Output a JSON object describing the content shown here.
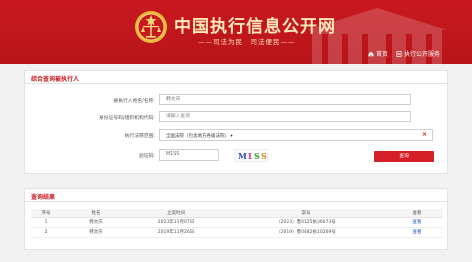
{
  "header": {
    "site_title": "中国执行信息公开网",
    "slogan": "——司法为民　司法便民——",
    "nav": [
      {
        "label": "首页",
        "icon": "home-icon"
      },
      {
        "label": "执行公开服务",
        "icon": "document-icon"
      }
    ]
  },
  "query_form": {
    "title": "综合查询被执行人",
    "fields": {
      "name_label": "被执行人姓名/名称:",
      "name_value": "韩文庆",
      "id_label": "身份证号码/组织机构代码:",
      "id_placeholder": "请输入查询",
      "court_label": "执行法院范围:",
      "court_value": "全国法院（包含地方各级法院）",
      "captcha_label": "验证码:",
      "captcha_value": "M1SS",
      "captcha_text": "M1SS"
    },
    "search_button": "查询"
  },
  "results": {
    "title": "查询结果",
    "columns": [
      "序号",
      "姓名",
      "立案时间",
      "案号",
      "查看"
    ],
    "rows": [
      {
        "index": "1",
        "name": "韩文庆",
        "date": "2023年11月07日",
        "case_no": "（2023）鲁0125执36673号",
        "action": "查看"
      },
      {
        "index": "2",
        "name": "韩文庆",
        "date": "2019年11月26日",
        "case_no": "（2019）鲁0482执10269号",
        "action": "查看"
      }
    ]
  },
  "colors": {
    "brand_red": "#c8191f",
    "button_red": "#d31f25",
    "link_blue": "#1a56c8",
    "title_gold": "#ffe9b8"
  }
}
